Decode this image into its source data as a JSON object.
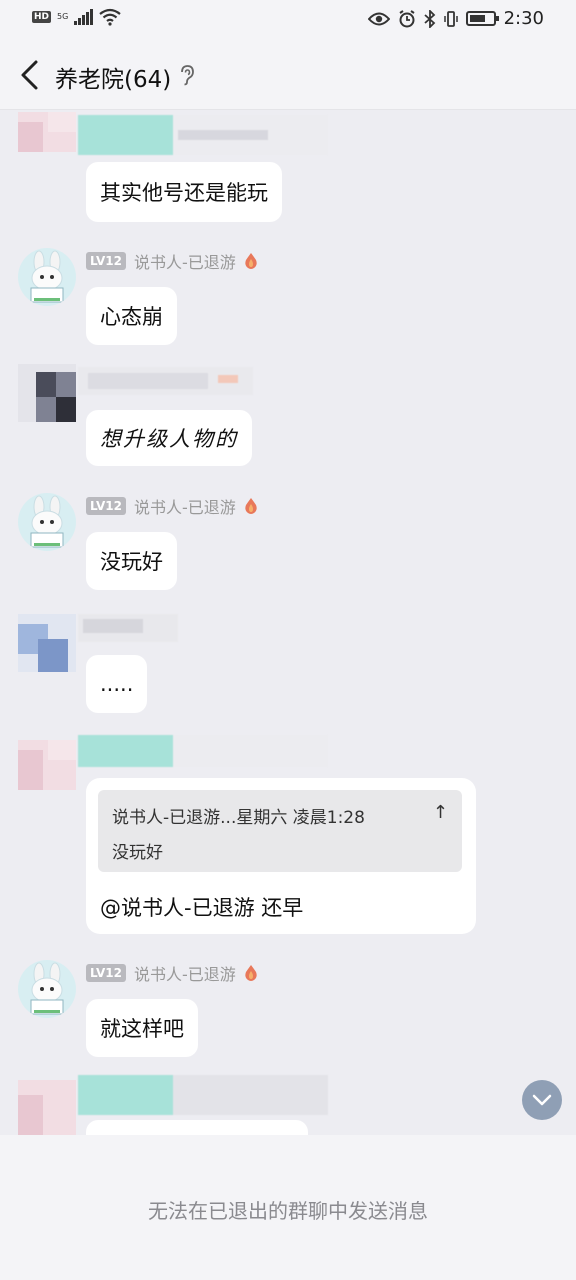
{
  "status_bar": {
    "hd": "HD",
    "net": "5G",
    "time": "2:30"
  },
  "header": {
    "title": "养老院(64)"
  },
  "messages": [
    {
      "text": "其实他号还是能玩"
    },
    {
      "level": "LV12",
      "sender": "说书人-已退游",
      "text": "心态崩"
    },
    {
      "text": "想升级人物的"
    },
    {
      "level": "LV12",
      "sender": "说书人-已退游",
      "text": "没玩好"
    },
    {
      "text": "....."
    },
    {
      "quote_head": "说书人-已退游...星期六 凌晨1:28",
      "quote_body": "没玩好",
      "text": "@说书人-已退游 还早"
    },
    {
      "level": "LV12",
      "sender": "说书人-已退游",
      "text": "就这样吧"
    }
  ],
  "footer": {
    "notice": "无法在已退出的群聊中发送消息"
  },
  "colors": {
    "background": "#ededf2",
    "bubble": "#ffffff",
    "badge": "#b9b9be",
    "scroll_button": "#8f9fb5"
  }
}
